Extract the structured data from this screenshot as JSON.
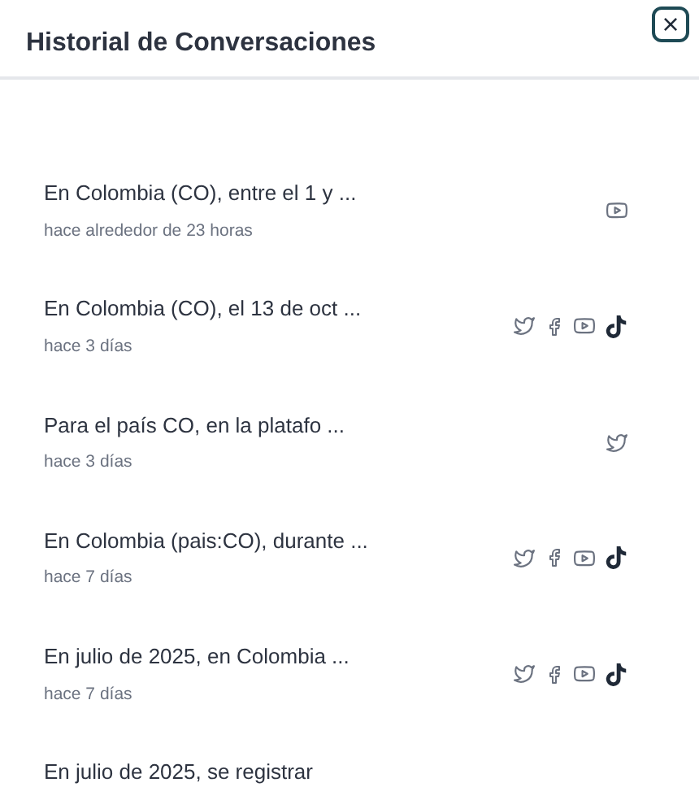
{
  "header": {
    "title": "Historial de Conversaciones",
    "close": "×"
  },
  "conversations": [
    {
      "title": "En Colombia (CO), entre el 1 y ...",
      "time": "hace alrededor de 23 horas",
      "platforms": [
        {
          "kind": "youtube"
        }
      ]
    },
    {
      "title": "En Colombia (CO), el 13 de oct ...",
      "time": "hace 3 días",
      "platforms": [
        {
          "kind": "twitter"
        },
        {
          "kind": "facebook"
        },
        {
          "kind": "youtube"
        },
        {
          "kind": "tiktok"
        }
      ]
    },
    {
      "title": "Para el país CO, en la platafo ...",
      "time": "hace 3 días",
      "platforms": [
        {
          "kind": "twitter"
        }
      ]
    },
    {
      "title": "En Colombia (pais:CO), durante ...",
      "time": "hace 7 días",
      "platforms": [
        {
          "kind": "twitter"
        },
        {
          "kind": "facebook"
        },
        {
          "kind": "youtube"
        },
        {
          "kind": "tiktok"
        }
      ]
    },
    {
      "title": "En julio de 2025, en Colombia ...",
      "time": "hace 7 días",
      "platforms": [
        {
          "kind": "twitter"
        },
        {
          "kind": "facebook"
        },
        {
          "kind": "youtube"
        },
        {
          "kind": "tiktok"
        }
      ]
    },
    {
      "title": "En julio de 2025, se registrar"
    }
  ]
}
